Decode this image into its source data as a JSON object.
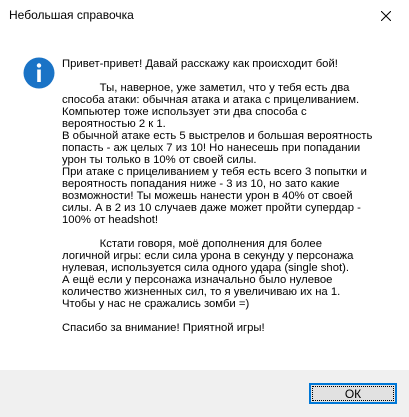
{
  "window": {
    "title": "Небольшая справочка",
    "close_icon": "close-icon"
  },
  "message": {
    "icon": "info-icon",
    "icon_color": "#1a73c6",
    "greeting": "Привет-привет! Давай расскажу как происходит бой!",
    "attacks": "            Ты, наверное, уже заметил, что у тебя есть два\nспособа атаки: обычная атака и атака с прицеливанием.\nКомпьютер тоже использует эти два способа с\nвероятностью 2 к 1.\nВ обычной атаке есть 5 выстрелов и большая вероятность\nпопасть - аж целых 7 из 10! Но нанесешь при попадании\nурон ты только в 10% от своей силы.\nПри атаке с прицеливанием у тебя есть всего 3 попытки и\nвероятность попадания ниже - 3 из 10, но зато какие\nвозможности! Ты можешь нанести урон в 40% от своей\nсилы. А в 2 из 10 случаев даже может пройти супердар -\n100% от headshot!",
    "additions": "            Кстати говоря, моё дополнения для более\nлогичной игры: если сила урона в секунду у персонажа\nнулевая, используется сила одного удара (single shot).\nА ещё если у персонажа изначально было нулевое\nколичество жизненных сил, то я увеличиваю их на 1.\nЧтобы у нас не сражались зомби =)",
    "thanks": "Спасибо за внимание! Приятной игры!"
  },
  "footer": {
    "ok_label": "ОК",
    "accent_color": "#0078d7"
  }
}
